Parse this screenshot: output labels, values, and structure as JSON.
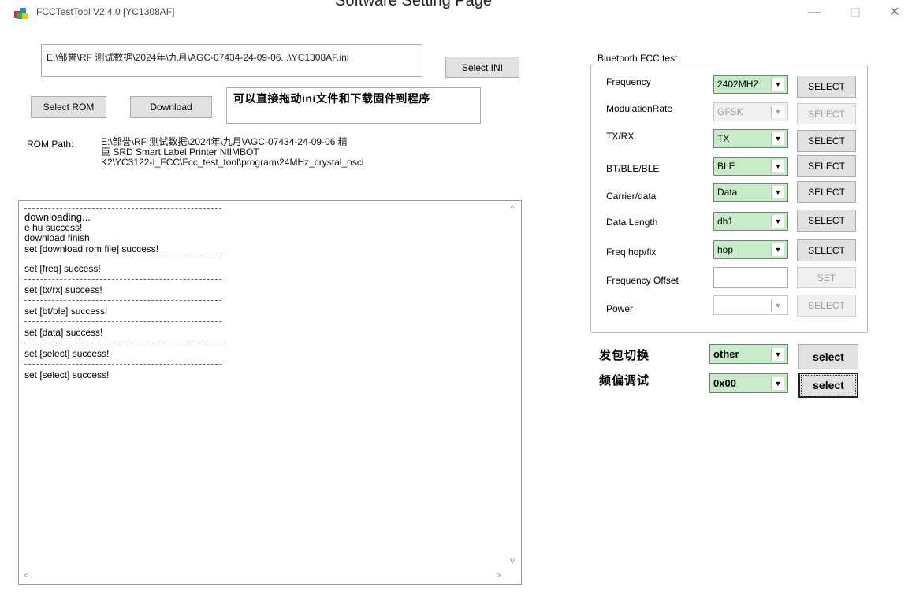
{
  "clip_title": "Software Setting Page",
  "window": {
    "title": "FCCTestTool V2.4.0 [YC1308AF]",
    "min_icon": "minimize-icon",
    "max_icon": "maximize-icon",
    "close_icon": "close-icon"
  },
  "ini": {
    "path": "E:\\邹誉\\RF 测试数据\\2024年\\九月\\AGC-07434-24-09-06...\\YC1308AF.ini",
    "select_label": "Select INI"
  },
  "rom": {
    "select_label": "Select ROM",
    "download_label": "Download",
    "hint": "可以直接拖动ini文件和下载固件到程序",
    "path_label": "ROM Path:",
    "path_lines": [
      "E:\\邹誉\\RF 测试数据\\2024年\\九月\\AGC-07434-24-09-06 精",
      "臣 SRD  Smart Label Printer  NIIMBOT",
      "K2\\YC3122-I_FCC\\Fcc_test_tool\\program\\24MHz_crystal_osci"
    ]
  },
  "log": {
    "lines": [
      "downloading...",
      "e hu success!",
      "download finish",
      "set [download rom file] success!",
      "set [freq] success!",
      "set [tx/rx] success!",
      "set [bt/ble] success!",
      "set [data] success!",
      "set [select] success!",
      "set [select] success!"
    ]
  },
  "bt": {
    "group_title": "Bluetooth FCC test",
    "rows": [
      {
        "label": "Frequency",
        "value": "2402MHZ",
        "button": "SELECT"
      },
      {
        "label": "ModulationRate",
        "value": "GFSK",
        "button": "SELECT"
      },
      {
        "label": "TX/RX",
        "value": "TX",
        "button": "SELECT"
      },
      {
        "label": "BT/BLE/BLE",
        "value": "BLE",
        "button": "SELECT"
      },
      {
        "label": "Carrier/data",
        "value": "Data",
        "button": "SELECT"
      },
      {
        "label": "Data Length",
        "value": "dh1",
        "button": "SELECT"
      },
      {
        "label": "Freq hop/fix",
        "value": "hop",
        "button": "SELECT"
      },
      {
        "label": "Frequency Offset",
        "value": "",
        "button": "SET"
      },
      {
        "label": "Power",
        "value": "",
        "button": "SELECT"
      }
    ]
  },
  "extra": {
    "packet_label": "发包切换",
    "packet_value": "other",
    "packet_button": "select",
    "offset_label": "频偏调试",
    "offset_value": "0x00",
    "offset_button": "select"
  },
  "colors": {
    "combo_active": "#c8ecca",
    "button_bg": "#e1e1e1"
  }
}
